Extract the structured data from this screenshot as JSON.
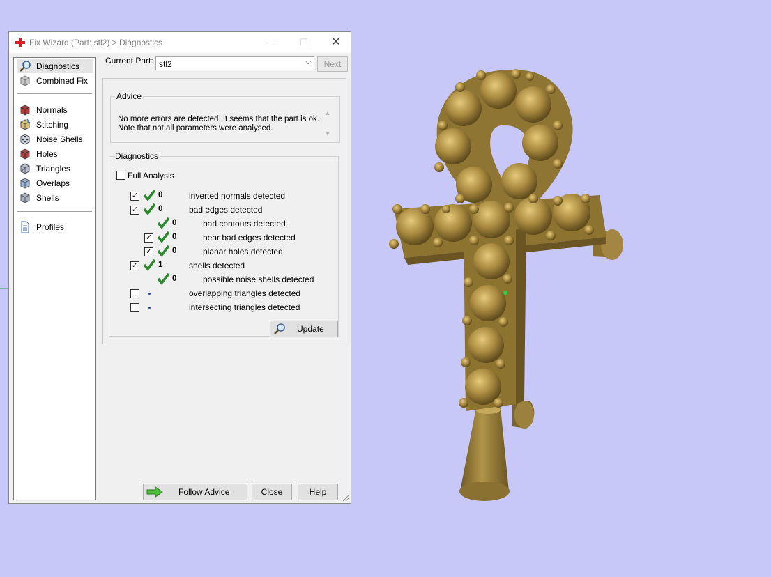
{
  "window": {
    "title": "Fix Wizard (Part: stl2) > Diagnostics",
    "minimize_glyph": "—",
    "maximize_glyph": "☐",
    "close_glyph": "✕"
  },
  "sidebar": {
    "items": [
      {
        "label": "Diagnostics",
        "icon": "magnifier-icon"
      },
      {
        "label": "Combined Fix",
        "icon": "cube-stack-icon"
      },
      {
        "label": "Normals",
        "icon": "cube-normals-icon"
      },
      {
        "label": "Stitching",
        "icon": "cube-stitch-icon"
      },
      {
        "label": "Noise Shells",
        "icon": "noise-dice-icon"
      },
      {
        "label": "Holes",
        "icon": "cube-holes-icon"
      },
      {
        "label": "Triangles",
        "icon": "cube-triangles-icon"
      },
      {
        "label": "Overlaps",
        "icon": "cube-overlaps-icon"
      },
      {
        "label": "Shells",
        "icon": "cube-shells-icon"
      },
      {
        "label": "Profiles",
        "icon": "document-icon"
      }
    ],
    "selected": "Diagnostics"
  },
  "current_part": {
    "label": "Current Part:",
    "value": "stl2",
    "next_label": "Next"
  },
  "advice": {
    "legend": "Advice",
    "text_line1": "No more errors are detected. It seems that the part is ok.",
    "text_line2": "Note that not all parameters were analysed."
  },
  "diagnostics": {
    "legend": "Diagnostics",
    "full_analysis_label": "Full Analysis",
    "full_analysis_checked": false,
    "rows": [
      {
        "checked": true,
        "status": "ok",
        "count": "0",
        "label": "inverted normals detected"
      },
      {
        "checked": true,
        "status": "ok",
        "count": "0",
        "label": "bad edges detected"
      },
      {
        "checked": null,
        "status": "ok",
        "count": "0",
        "label": "bad contours detected"
      },
      {
        "checked": true,
        "status": "ok",
        "count": "0",
        "label": "near bad edges detected"
      },
      {
        "checked": true,
        "status": "ok",
        "count": "0",
        "label": "planar holes detected"
      },
      {
        "checked": true,
        "status": "ok",
        "count": "1",
        "label": "shells detected"
      },
      {
        "checked": null,
        "status": "ok",
        "count": "0",
        "label": "possible noise shells detected"
      },
      {
        "checked": false,
        "status": "not-run",
        "count": "",
        "label": "overlapping triangles detected"
      },
      {
        "checked": false,
        "status": "not-run",
        "count": "",
        "label": "intersecting triangles detected"
      }
    ],
    "update_label": "Update"
  },
  "footer": {
    "follow_advice_label": "Follow Advice",
    "close_label": "Close",
    "help_label": "Help"
  },
  "colors": {
    "viewport_background": "#c8c8f8",
    "model_gold": "#a8893f",
    "check_green": "#2a8a2a",
    "not_run_dot": "#1e3fae"
  }
}
